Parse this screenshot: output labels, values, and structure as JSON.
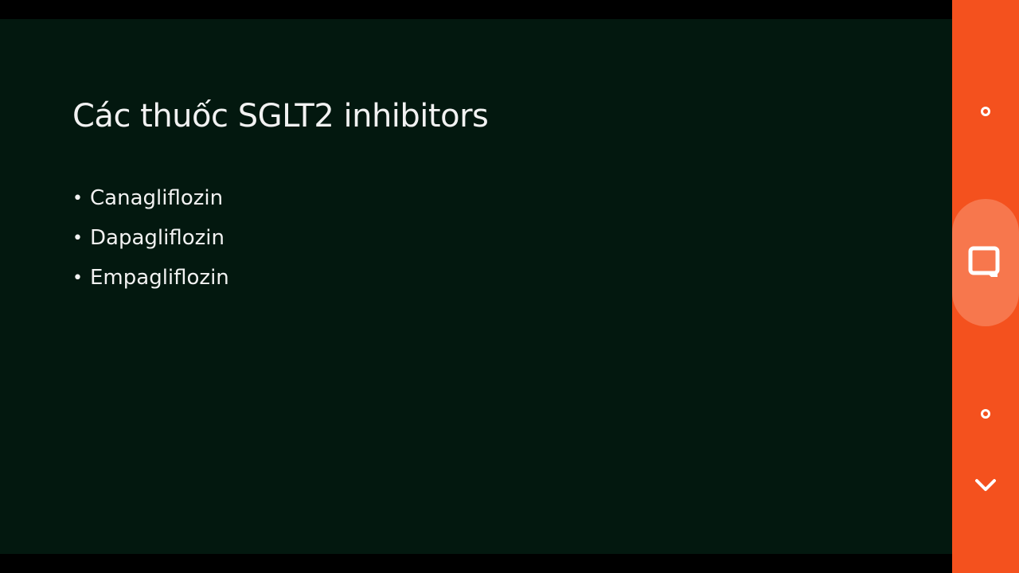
{
  "slide": {
    "title": "Các thuốc SGLT2 inhibitors",
    "bullet_symbol": "•",
    "bullets": [
      "Canagliflozin",
      "Dapagliflozin",
      "Empagliflozin"
    ]
  },
  "side_panel": {
    "color": "#f4511e",
    "highlight_color": "#f7774d",
    "buttons": [
      "circle-icon",
      "book-icon",
      "circle-icon",
      "chevron-down-icon"
    ]
  },
  "colors": {
    "slide_background": "#03180f",
    "text": "#f2f2f2"
  }
}
